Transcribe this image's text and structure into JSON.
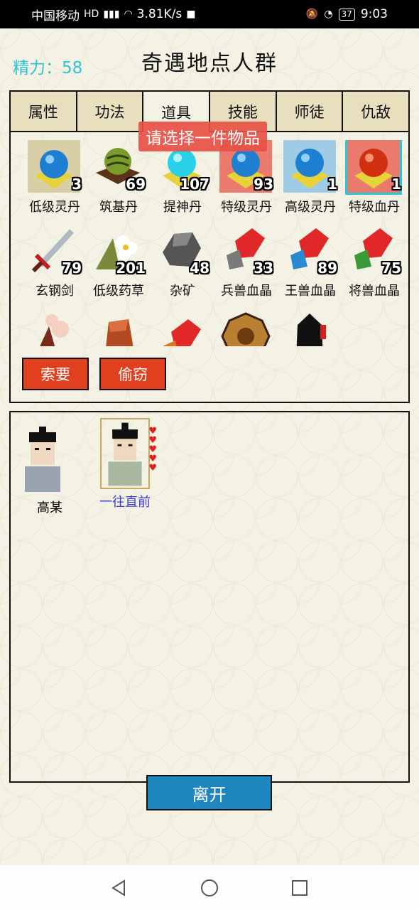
{
  "status_bar": {
    "carrier": "中国移动",
    "speed": "3.81K/s",
    "battery": "37",
    "time": "9:03"
  },
  "header": {
    "energy": "精力：58",
    "title": "奇遇地点人群"
  },
  "tabs": [
    "属性",
    "功法",
    "道具",
    "技能",
    "师徒",
    "仇敌"
  ],
  "toast": "请选择一件物品",
  "items": [
    {
      "name": "低级灵丹",
      "count": "3"
    },
    {
      "name": "筑基丹",
      "count": "69"
    },
    {
      "name": "提神丹",
      "count": "107"
    },
    {
      "name": "特级灵丹",
      "count": "93"
    },
    {
      "name": "高级灵丹",
      "count": "1"
    },
    {
      "name": "特级血丹",
      "count": "1"
    },
    {
      "name": "玄钢剑",
      "count": "79"
    },
    {
      "name": "低级药草",
      "count": "201"
    },
    {
      "name": "杂矿",
      "count": "48"
    },
    {
      "name": "兵兽血晶",
      "count": "33"
    },
    {
      "name": "王兽血晶",
      "count": "89"
    },
    {
      "name": "将兽血晶",
      "count": "75"
    }
  ],
  "actions": {
    "demand": "索要",
    "steal": "偷窃"
  },
  "npcs": [
    {
      "name": "高某"
    },
    {
      "name": "一往直前"
    }
  ],
  "leave_button": "离开",
  "colors": {
    "accent_cyan": "#2fc4d4",
    "button_red": "#e0401e",
    "button_blue": "#1f87c0",
    "highlight_name": "#3a3adc"
  }
}
